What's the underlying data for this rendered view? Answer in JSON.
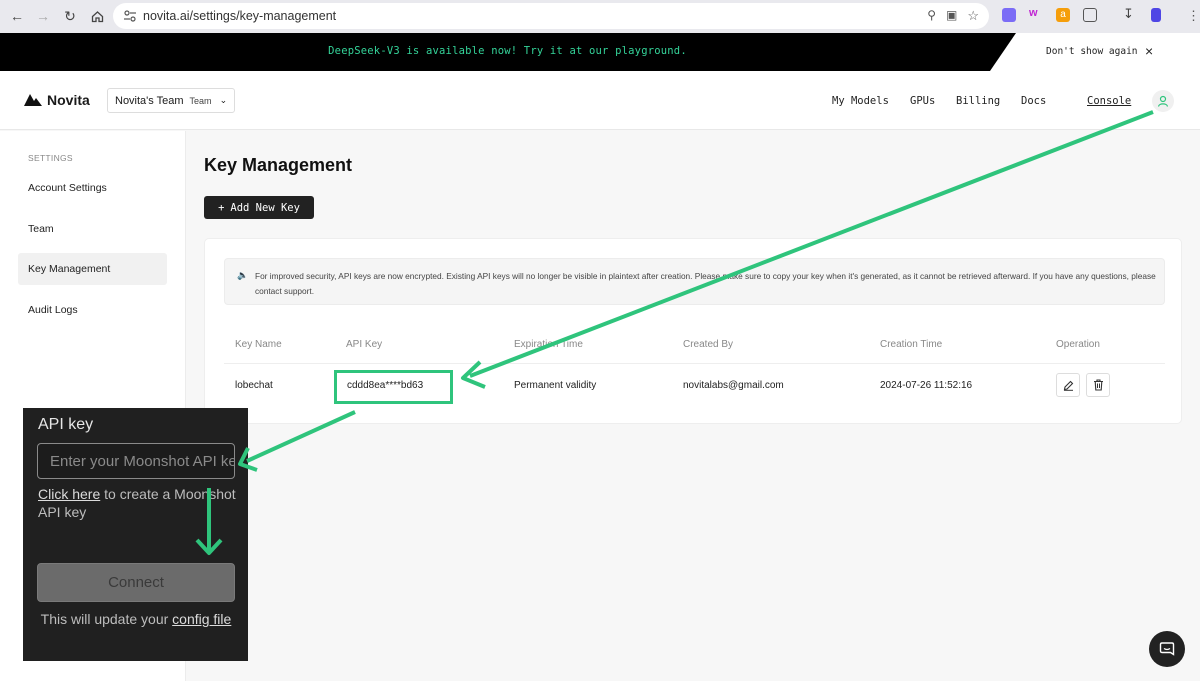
{
  "browser": {
    "url": "novita.ai/settings/key-management"
  },
  "banner": {
    "message": "DeepSeek-V3 is available now! Try it at our playground.",
    "dismiss_label": "Don't show again"
  },
  "header": {
    "logo_text": "Novita",
    "team_name": "Novita's Team",
    "team_badge": "Team",
    "nav": [
      "My Models",
      "GPUs",
      "Billing",
      "Docs"
    ],
    "console_label": "Console"
  },
  "sidebar": {
    "section_title": "SETTINGS",
    "items": [
      {
        "label": "Account Settings",
        "active": false
      },
      {
        "label": "Team",
        "active": false
      },
      {
        "label": "Key Management",
        "active": true
      },
      {
        "label": "Audit Logs",
        "active": false
      }
    ]
  },
  "main": {
    "title": "Key Management",
    "add_button_label": "Add New Key",
    "notice": "For improved security, API keys are now encrypted. Existing API keys will no longer be visible in plaintext after creation. Please make sure to copy your key when it's generated, as it cannot be retrieved afterward. If you have any questions, please contact support.",
    "table": {
      "headers": [
        "Key Name",
        "API Key",
        "Expiration Time",
        "Created By",
        "Creation Time",
        "Operation"
      ],
      "rows": [
        {
          "key_name": "lobechat",
          "api_key": "cddd8ea****bd63",
          "expiration": "Permanent validity",
          "created_by": "novitalabs@gmail.com",
          "creation_time": "2024-07-26 11:52:16"
        }
      ]
    }
  },
  "overlay": {
    "title": "API key",
    "input_placeholder": "Enter your Moonshot API key",
    "link_text": "Click here",
    "link_suffix": "to create a Moonshot API key",
    "connect_label": "Connect",
    "note_prefix": "This will update your",
    "note_link": "config file"
  },
  "colors": {
    "annotation_green": "#2fc47c",
    "banner_text_green": "#34d399"
  }
}
